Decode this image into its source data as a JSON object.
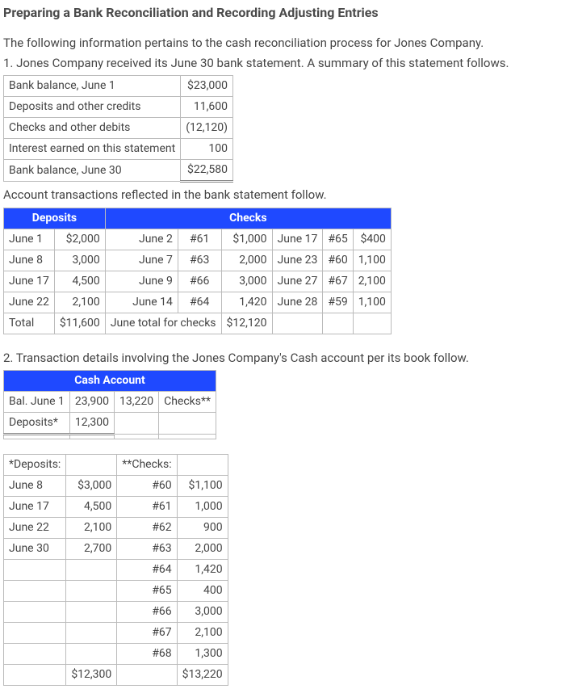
{
  "title": "Preparing a Bank Reconciliation and Recording Adjusting Entries",
  "intro": "The following information pertains to the cash reconciliation process for Jones Company.",
  "step1": "1. Jones Company received its June 30 bank statement. A summary of this statement follows.",
  "summary_table": {
    "rows": [
      {
        "label": "Bank balance, June 1",
        "value": "$23,000"
      },
      {
        "label": "Deposits and other credits",
        "value": "11,600"
      },
      {
        "label": "Checks and other debits",
        "value": "(12,120)"
      },
      {
        "label": "Interest earned on this statement",
        "value": "100"
      },
      {
        "label": "Bank balance, June 30",
        "value": "$22,580"
      }
    ]
  },
  "subtitle1": "Account transactions reflected in the bank statement follow.",
  "trans_table": {
    "hdr_deposits": "Deposits",
    "hdr_checks": "Checks",
    "rows": [
      {
        "c0": "June 1",
        "c1": "$2,000",
        "c2": "June 2",
        "c3": "#61",
        "c4": "$1,000",
        "c5": "June 17",
        "c6": "#65",
        "c7": "$400"
      },
      {
        "c0": "June 8",
        "c1": "3,000",
        "c2": "June 7",
        "c3": "#63",
        "c4": "2,000",
        "c5": "June 23",
        "c6": "#60",
        "c7": "1,100"
      },
      {
        "c0": "June 17",
        "c1": "4,500",
        "c2": "June 9",
        "c3": "#66",
        "c4": "3,000",
        "c5": "June 27",
        "c6": "#67",
        "c7": "2,100"
      },
      {
        "c0": "June 22",
        "c1": "2,100",
        "c2": "June 14",
        "c3": "#64",
        "c4": "1,420",
        "c5": "June 28",
        "c6": "#59",
        "c7": "1,100"
      }
    ],
    "total": {
      "c0": "Total",
      "c1": "$11,600",
      "c2": "June total for checks",
      "c4": "$12,120"
    }
  },
  "step2": "2. Transaction details involving the Jones Company's Cash account per its book follow.",
  "cash_table": {
    "hdr": "Cash Account",
    "rows": [
      {
        "c0": "Bal. June 1",
        "c1": "23,900",
        "c2": "13,220",
        "c3": "Checks**"
      },
      {
        "c0": "Deposits*",
        "c1": "12,300",
        "c2": "",
        "c3": ""
      },
      {
        "c0": "",
        "c1": "",
        "c2": "",
        "c3": ""
      }
    ]
  },
  "detail_table": {
    "hdr_dep": "*Deposits:",
    "hdr_chk": "**Checks:",
    "rows": [
      {
        "c0": "June 8",
        "c1": "$3,000",
        "c2": "#60",
        "c3": "$1,100"
      },
      {
        "c0": "June 17",
        "c1": "4,500",
        "c2": "#61",
        "c3": "1,000"
      },
      {
        "c0": "June 22",
        "c1": "2,100",
        "c2": "#62",
        "c3": "900"
      },
      {
        "c0": "June 30",
        "c1": "2,700",
        "c2": "#63",
        "c3": "2,000"
      },
      {
        "c0": "",
        "c1": "",
        "c2": "#64",
        "c3": "1,420"
      },
      {
        "c0": "",
        "c1": "",
        "c2": "#65",
        "c3": "400"
      },
      {
        "c0": "",
        "c1": "",
        "c2": "#66",
        "c3": "3,000"
      },
      {
        "c0": "",
        "c1": "",
        "c2": "#67",
        "c3": "2,100"
      },
      {
        "c0": "",
        "c1": "",
        "c2": "#68",
        "c3": "1,300"
      },
      {
        "c0": "",
        "c1": "$12,300",
        "c2": "",
        "c3": "$13,220"
      }
    ]
  }
}
